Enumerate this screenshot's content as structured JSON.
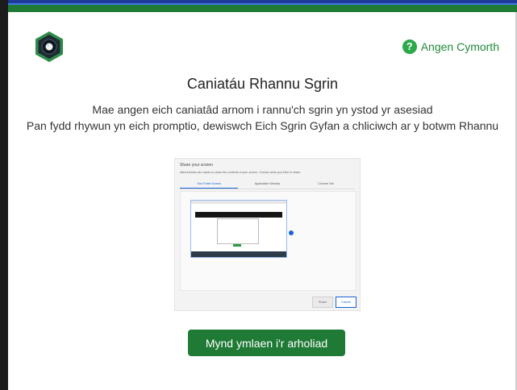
{
  "help": {
    "label": "Angen Cymorth",
    "icon": "question-circle-icon",
    "icon_glyph": "?"
  },
  "page": {
    "title": "Caniatáu Rhannu Sgrin",
    "description_line1": "Mae angen eich caniatâd arnom i rannu'ch sgrin yn ystod yr asesiad",
    "description_line2": "Pan fydd rhywun yn eich promptio, dewiswch Eich Sgrin Gyfan a chliciwch ar y botwm Rhannu"
  },
  "preview": {
    "title": "Share your screen",
    "subtitle": "attend.testee.dev wants to share the contents of your screen. Choose what you'd like to share.",
    "tabs": [
      "Your Entire Screen",
      "Application Window",
      "Chrome Tab"
    ],
    "share_label": "Share",
    "cancel_label": "Cancel"
  },
  "actions": {
    "proceed_label": "Mynd ymlaen i'r arholiad"
  },
  "colors": {
    "brand_green": "#1f7a36",
    "help_green": "#2aa84a",
    "accent_blue": "#1a63d6"
  }
}
